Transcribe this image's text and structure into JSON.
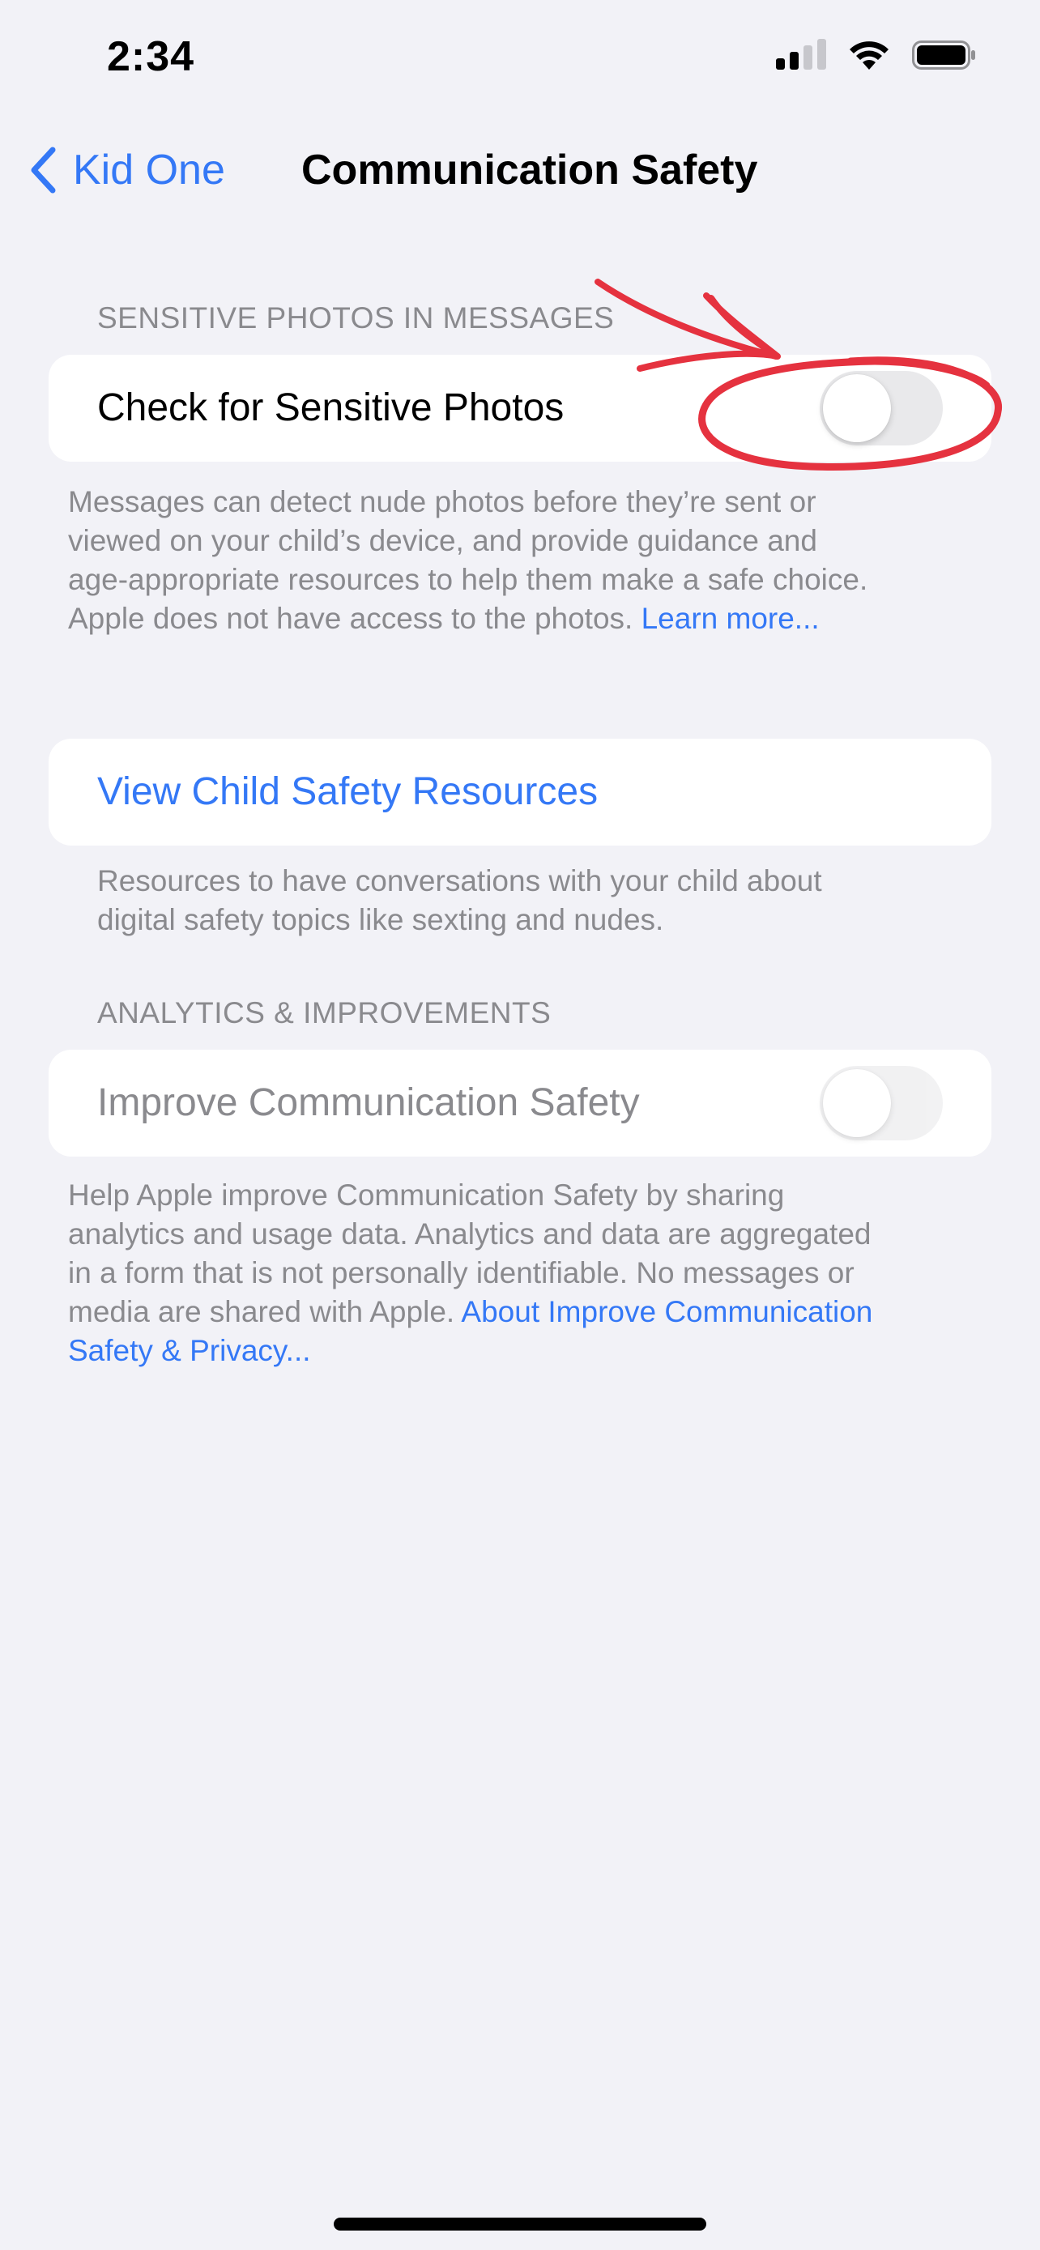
{
  "status_bar": {
    "time": "2:34",
    "icons": [
      "cellular-signal-icon",
      "wifi-icon",
      "battery-icon"
    ]
  },
  "nav": {
    "back_label": "Kid One",
    "title": "Communication Safety"
  },
  "sensitive_photos": {
    "header": "SENSITIVE PHOTOS IN MESSAGES",
    "toggle_label": "Check for Sensitive Photos",
    "toggle_on": false,
    "footer_lines": [
      "Messages can detect nude photos before they’re sent or",
      "viewed on your child’s device, and provide guidance and",
      "age-appropriate resources to help them make a safe choice."
    ],
    "footer_last_line": "Apple does not have access to the photos.",
    "footer_link": "Learn more..."
  },
  "resources": {
    "link_label": "View Child Safety Resources",
    "footer_lines": [
      "Resources to have conversations with your child about",
      "digital safety topics like sexting and nudes."
    ]
  },
  "analytics": {
    "header": "ANALYTICS & IMPROVEMENTS",
    "toggle_label": "Improve Communication Safety",
    "toggle_on": false,
    "toggle_enabled": false,
    "footer_lines": [
      "Help Apple improve Communication Safety by sharing",
      "analytics and usage data. Analytics and data are aggregated",
      "in a form that is not personally identifiable. No messages or"
    ],
    "footer_line4_text": "media are shared with Apple.",
    "footer_link_part1": "About Improve Communication",
    "footer_link_part2": "Safety & Privacy..."
  },
  "colors": {
    "background": "#f2f2f7",
    "accent": "#3478f6",
    "secondary_text": "#8a8a8e",
    "annotation": "#e5323f"
  }
}
